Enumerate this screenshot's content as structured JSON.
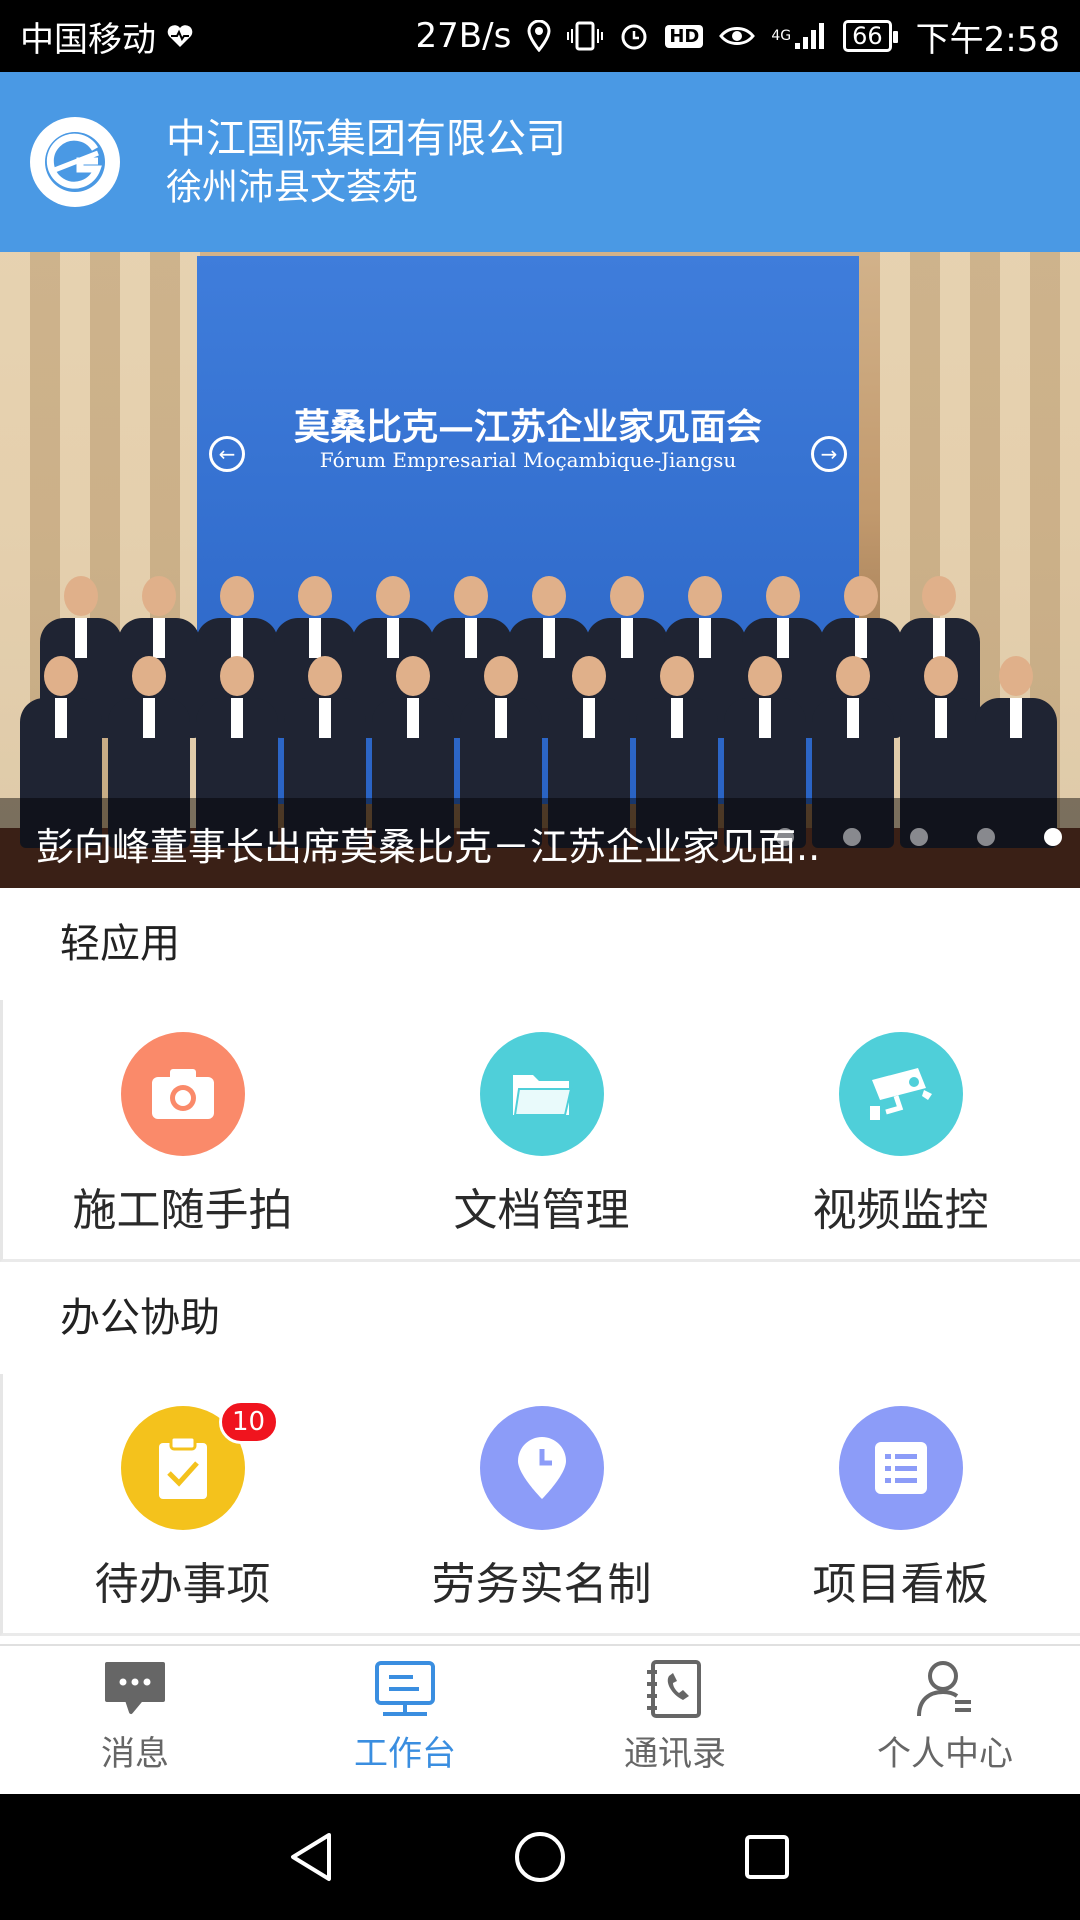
{
  "status_bar": {
    "carrier": "中国移动",
    "net_speed": "27B/s",
    "hd": "HD",
    "signal": "4G",
    "battery": "66",
    "time": "下午2:58"
  },
  "header": {
    "company": "中江国际集团有限公司",
    "project": "徐州沛县文荟苑"
  },
  "banner": {
    "screen_title_cn": "莫桑比克—江苏企业家见面会",
    "screen_title_pt": "Fórum Empresarial Moçambique-Jiangsu",
    "caption": "彭向峰董事长出席莫桑比克－江苏企业家见面..",
    "page_count": 5,
    "active_page": 5
  },
  "sections": [
    {
      "title": "轻应用",
      "apps": [
        {
          "label": "施工随手拍",
          "icon": "camera-icon",
          "color": "#fa8a6a"
        },
        {
          "label": "文档管理",
          "icon": "folder-icon",
          "color": "#4fcfd9"
        },
        {
          "label": "视频监控",
          "icon": "cctv-camera-icon",
          "color": "#4fcfd9"
        }
      ]
    },
    {
      "title": "办公协助",
      "apps": [
        {
          "label": "待办事项",
          "icon": "clipboard-check-icon",
          "color": "#f4c21c",
          "badge": "10"
        },
        {
          "label": "劳务实名制",
          "icon": "location-clock-icon",
          "color": "#8c9cf8"
        },
        {
          "label": "项目看板",
          "icon": "list-board-icon",
          "color": "#8c9cf8"
        }
      ]
    }
  ],
  "tabs": [
    {
      "label": "消息",
      "icon": "message-icon"
    },
    {
      "label": "工作台",
      "icon": "workbench-icon",
      "active": true
    },
    {
      "label": "通讯录",
      "icon": "contacts-icon"
    },
    {
      "label": "个人中心",
      "icon": "user-icon"
    }
  ],
  "colors": {
    "header": "#4a99e4",
    "tab_active": "#3a8ee0",
    "badge": "#f0141e"
  }
}
